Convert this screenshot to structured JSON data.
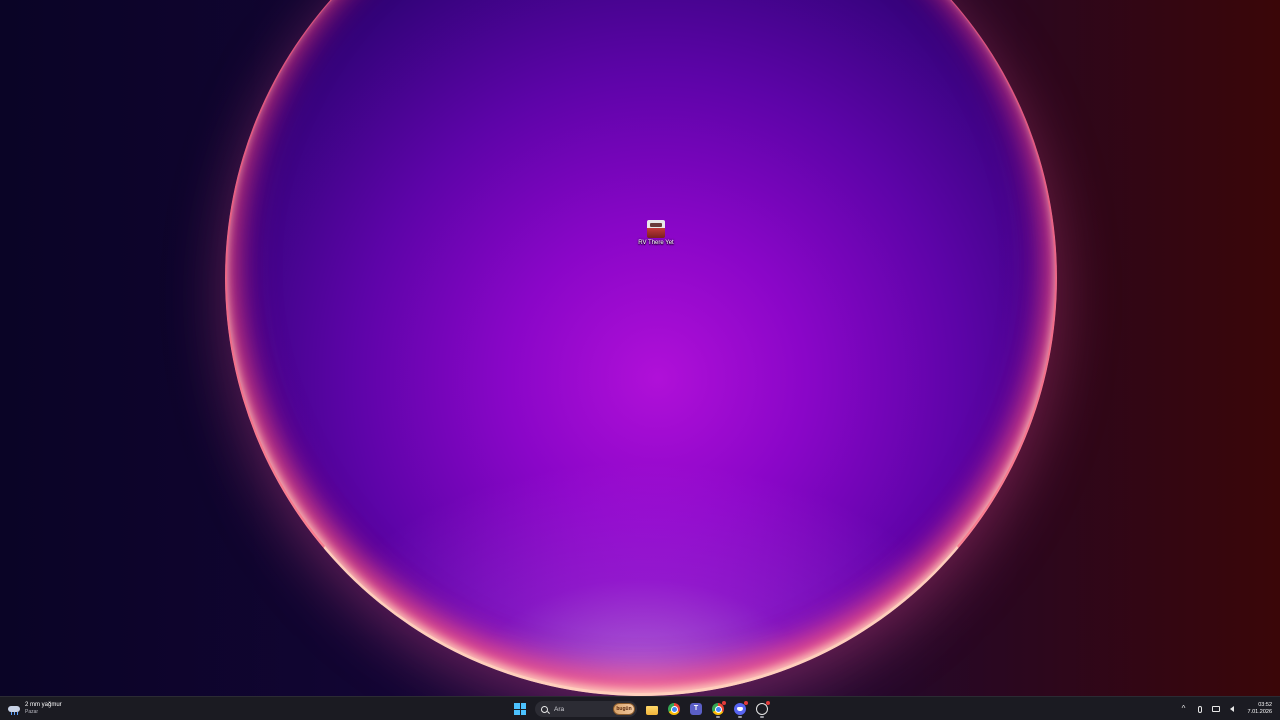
{
  "desktop": {
    "icons": [
      {
        "label": "RV There Yet"
      }
    ]
  },
  "taskbar": {
    "weather": {
      "summary": "2 mm yağmur",
      "day": "Pazar",
      "icon": "rain-cloud-icon"
    },
    "search": {
      "placeholder": "Ara",
      "badge": "bugün"
    },
    "pinned_apps": [
      {
        "name": "file-explorer",
        "icon": "folder-icon"
      },
      {
        "name": "google-chrome",
        "icon": "chrome-icon"
      },
      {
        "name": "microsoft-teams",
        "icon": "teams-icon"
      },
      {
        "name": "google-chrome-profile",
        "icon": "chrome-icon"
      },
      {
        "name": "discord",
        "icon": "discord-icon"
      },
      {
        "name": "github-desktop",
        "icon": "github-icon"
      }
    ],
    "tray": {
      "overflow_glyph": "^",
      "time": "03:52",
      "date": "7.01.2026"
    }
  },
  "colors": {
    "taskbar_bg": "#1b1b22",
    "windows_accent": "#4cc2ff",
    "notification_badge": "#e23b3b"
  }
}
